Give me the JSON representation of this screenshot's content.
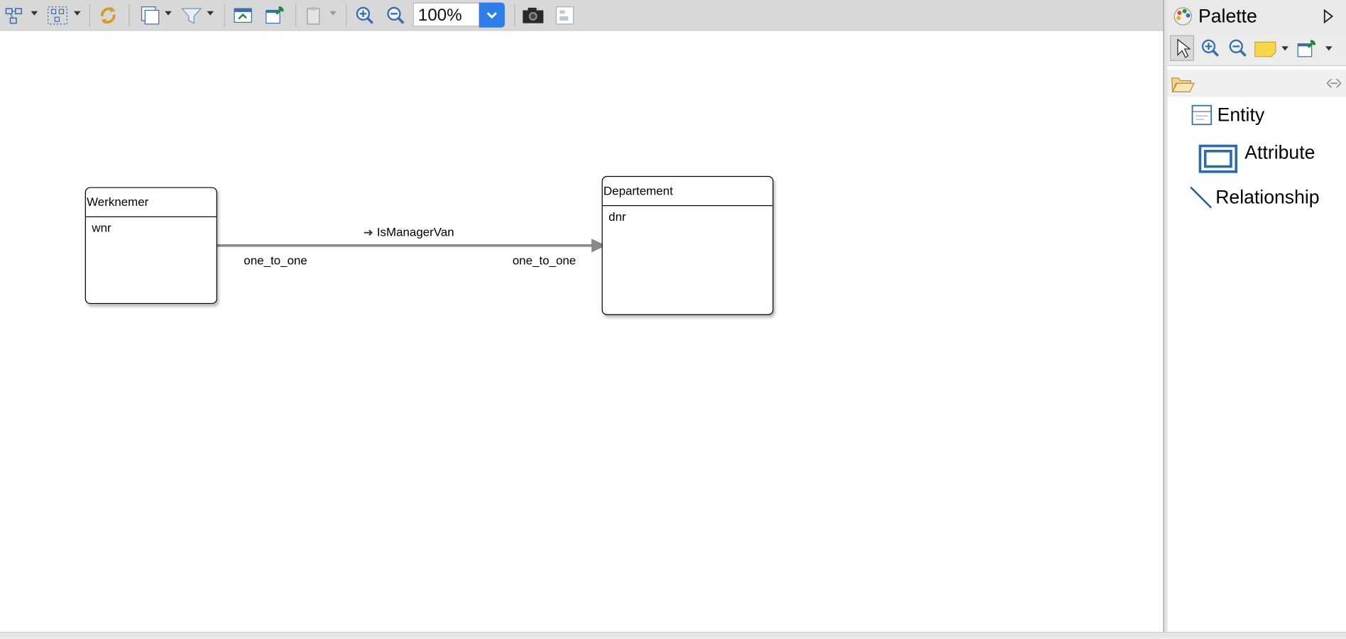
{
  "toolbar": {
    "zoom_value": "100%"
  },
  "diagram": {
    "entities": [
      {
        "name": "Werknemer",
        "attributes": [
          "wnr"
        ]
      },
      {
        "name": "Departement",
        "attributes": [
          "dnr"
        ]
      }
    ],
    "relationship": {
      "name": "IsManagerVan",
      "source_cardinality": "one_to_one",
      "target_cardinality": "one_to_one"
    }
  },
  "palette": {
    "title": "Palette",
    "items": [
      {
        "label": "Entity",
        "icon": "entity-icon"
      },
      {
        "label": "Attribute",
        "icon": "attribute-icon"
      },
      {
        "label": "Relationship",
        "icon": "relationship-icon"
      }
    ]
  },
  "colors": {
    "toolbar_bg": "#d8d8d8",
    "zoom_accent": "#2d7ee8",
    "edge": "#8a8a8a"
  }
}
